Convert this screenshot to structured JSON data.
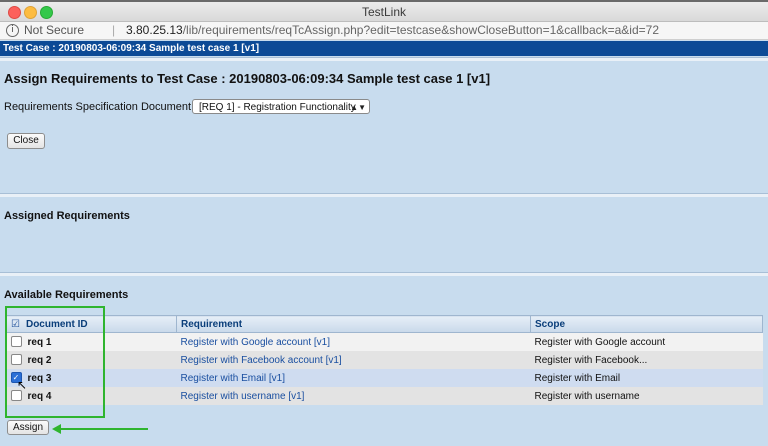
{
  "window": {
    "title": "TestLink"
  },
  "address_bar": {
    "security": "Not Secure",
    "host": "3.80.25.13",
    "path": "/lib/requirements/reqTcAssign.php?edit=testcase&showCloseButton=1&callback=a&id=72"
  },
  "header_bar": {
    "text": "Test Case : 20190803-06:09:34 Sample test case 1 [v1]"
  },
  "assign_section": {
    "heading": "Assign Requirements to Test Case : 20190803-06:09:34 Sample test case 1 [v1]",
    "spec_label": "Requirements Specification Document",
    "spec_selected": "[REQ 1] - Registration Functionality",
    "close_label": "Close"
  },
  "assigned_section": {
    "heading": "Assigned Requirements"
  },
  "available_section": {
    "heading": "Available Requirements",
    "columns": [
      "Document ID",
      "Requirement",
      "Scope"
    ],
    "rows": [
      {
        "doc_id": "req 1",
        "requirement": "Register with Google account [v1]",
        "scope": "Register with Google account",
        "checked": false
      },
      {
        "doc_id": "req 2",
        "requirement": "Register with Facebook account [v1]",
        "scope": "Register with Facebook...",
        "checked": false
      },
      {
        "doc_id": "req 3",
        "requirement": "Register with Email [v1]",
        "scope": "Register with Email",
        "checked": true
      },
      {
        "doc_id": "req 4",
        "requirement": "Register with username [v1]",
        "scope": "Register with username",
        "checked": false
      }
    ],
    "assign_label": "Assign"
  },
  "icons": {
    "info": "info-icon",
    "header_checkbox": "select-all-icon",
    "cursor": "mouse-pointer-icon"
  },
  "colors": {
    "header_bar": "#0c4a96",
    "page_bg": "#c8dcee",
    "link": "#1a4fa0",
    "highlight": "#2fb52f"
  }
}
